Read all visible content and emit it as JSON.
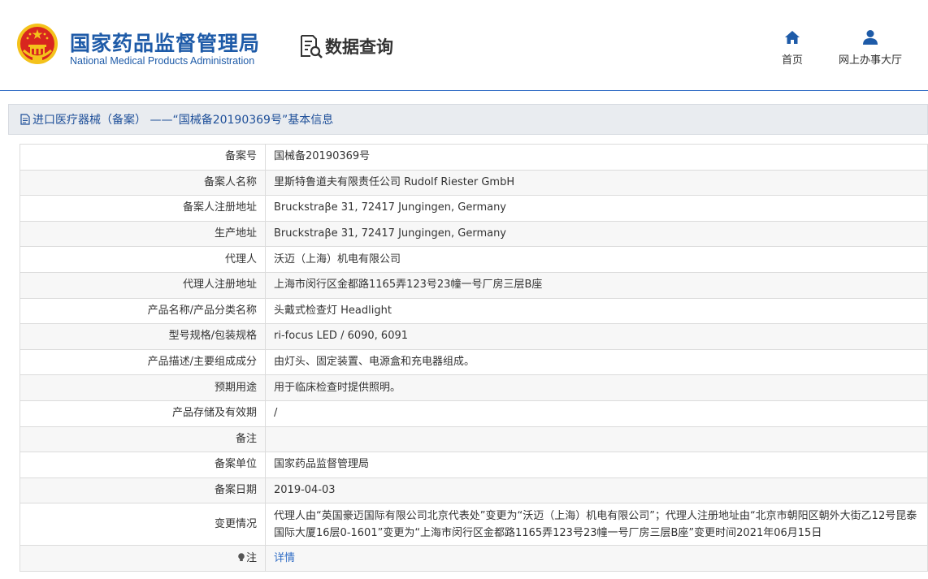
{
  "header": {
    "title_cn": "国家药品监督管理局",
    "title_en": "National Medical Products Administration",
    "data_query_label": "数据查询",
    "nav": {
      "home_label": "首页",
      "hall_label": "网上办事大厅",
      "home_icon": "home-icon",
      "hall_icon": "user-icon"
    }
  },
  "breadcrumb": {
    "text": "进口医疗器械（备案） ——“国械备20190369号”基本信息"
  },
  "colors": {
    "brand_blue": "#1e5ba8",
    "link_blue": "#2f6cc5",
    "emblem_red": "#d8261f",
    "emblem_gold": "#f4c21b"
  },
  "record": {
    "rows": [
      {
        "label": "备案号",
        "value": "国械备20190369号"
      },
      {
        "label": "备案人名称",
        "value": "里斯特鲁道夫有限责任公司 Rudolf Riester GmbH"
      },
      {
        "label": "备案人注册地址",
        "value": "Bruckstraβe 31, 72417 Jungingen, Germany"
      },
      {
        "label": "生产地址",
        "value": "Bruckstraβe 31, 72417 Jungingen, Germany"
      },
      {
        "label": "代理人",
        "value": "沃迈（上海）机电有限公司"
      },
      {
        "label": "代理人注册地址",
        "value": "上海市闵行区金都路1165弄123号23幢一号厂房三层B座"
      },
      {
        "label": "产品名称/产品分类名称",
        "value": "头戴式检查灯 Headlight"
      },
      {
        "label": "型号规格/包装规格",
        "value": "ri-focus LED / 6090, 6091"
      },
      {
        "label": "产品描述/主要组成成分",
        "value": "由灯头、固定装置、电源盒和充电器组成。"
      },
      {
        "label": "预期用途",
        "value": "用于临床检查时提供照明。"
      },
      {
        "label": "产品存储及有效期",
        "value": "/"
      },
      {
        "label": "备注",
        "value": ""
      },
      {
        "label": "备案单位",
        "value": "国家药品监督管理局"
      },
      {
        "label": "备案日期",
        "value": "2019-04-03"
      },
      {
        "label": "变更情况",
        "value": "代理人由“英国豪迈国际有限公司北京代表处”变更为“沃迈（上海）机电有限公司”；代理人注册地址由“北京市朝阳区朝外大街乙12号昆泰国际大厦16层0-1601”变更为“上海市闵行区金都路1165弄123号23幢一号厂房三层B座”变更时间2021年06月15日"
      }
    ],
    "note": {
      "label": "注",
      "link_text": "详情",
      "icon": "lightbulb-icon"
    }
  }
}
